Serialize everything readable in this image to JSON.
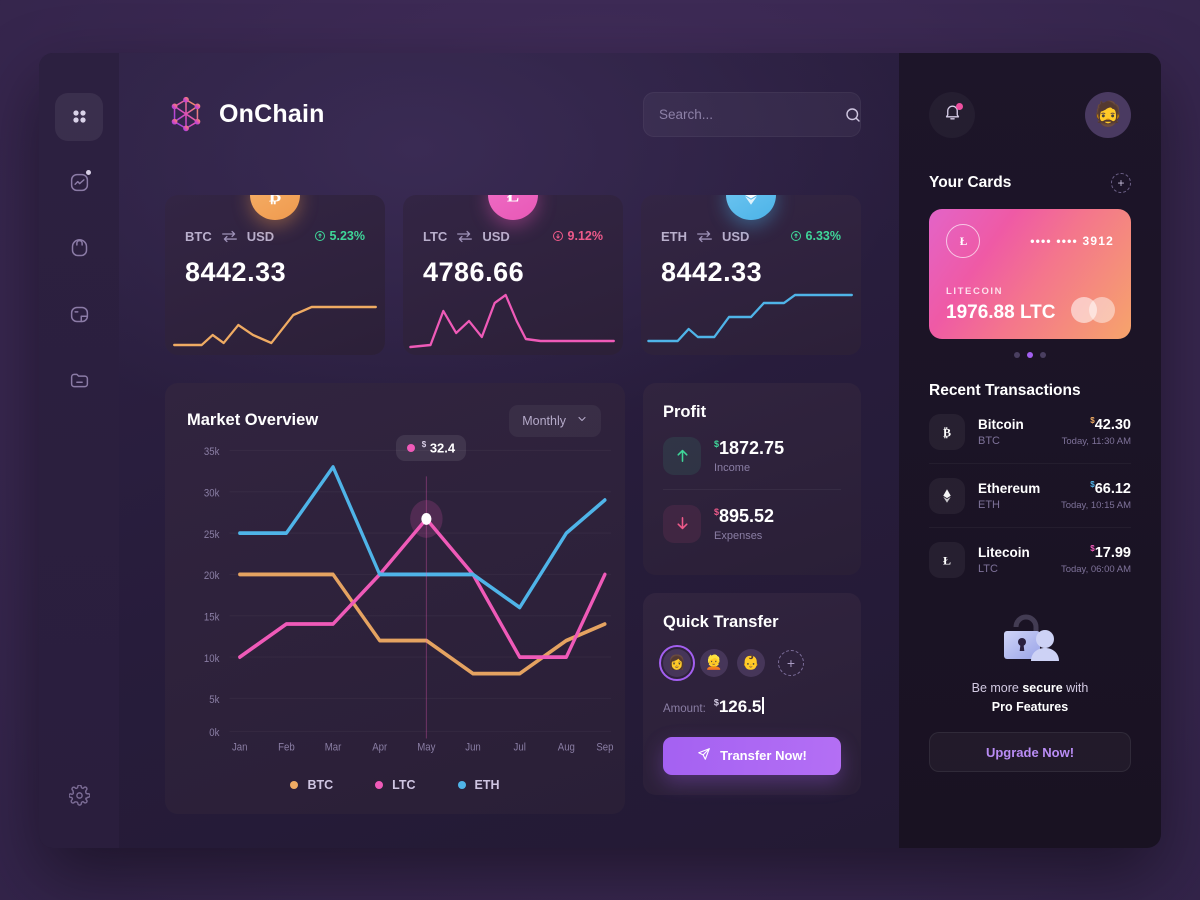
{
  "brand": {
    "name": "OnChain",
    "logo_icon": "hexagon-network-icon"
  },
  "sidebar": {
    "items": [
      {
        "name": "dashboard",
        "icon": "grid-icon",
        "active": true
      },
      {
        "name": "analytics",
        "icon": "chart-activity-icon",
        "active": false,
        "badge": true
      },
      {
        "name": "wallet",
        "icon": "bag-icon",
        "active": false
      },
      {
        "name": "portfolio",
        "icon": "pie-chart-icon",
        "active": false
      },
      {
        "name": "files",
        "icon": "folder-minus-icon",
        "active": false
      }
    ],
    "settings": {
      "name": "settings",
      "icon": "gear-icon"
    }
  },
  "search": {
    "placeholder": "Search...",
    "value": "",
    "icon": "search-icon"
  },
  "header": {
    "bell_icon": "bell-icon",
    "avatar_icon": "user-avatar",
    "notification_badge": true
  },
  "coin_cards": [
    {
      "symbol": "BTC",
      "quote": "USD",
      "change": "5.23%",
      "direction": "up",
      "value": "8442.33",
      "color": "#ef9a4e",
      "icon": "bitcoin-icon"
    },
    {
      "symbol": "LTC",
      "quote": "USD",
      "change": "9.12%",
      "direction": "down",
      "value": "4786.66",
      "color": "#e858b6",
      "icon": "litecoin-icon"
    },
    {
      "symbol": "ETH",
      "quote": "USD",
      "change": "6.33%",
      "direction": "up",
      "value": "8442.33",
      "color": "#4bb3e8",
      "icon": "ethereum-icon"
    }
  ],
  "market": {
    "title": "Market Overview",
    "period": "Monthly",
    "tooltip": {
      "currency": "$",
      "value": "32.4",
      "series": "LTC",
      "at_category": "May"
    }
  },
  "chart_data": {
    "type": "line",
    "title": "Market Overview",
    "xlabel": "",
    "ylabel": "",
    "categories": [
      "Jan",
      "Feb",
      "Mar",
      "Apr",
      "May",
      "Jun",
      "Jul",
      "Aug",
      "Sep"
    ],
    "ylim": [
      0,
      35000
    ],
    "yticks": [
      0,
      5000,
      10000,
      15000,
      20000,
      25000,
      30000,
      35000
    ],
    "ytick_labels": [
      "0k",
      "5k",
      "10k",
      "15k",
      "20k",
      "25k",
      "30k",
      "35k"
    ],
    "grid": true,
    "legend_position": "bottom",
    "series": [
      {
        "name": "BTC",
        "color": "#efab63",
        "values": [
          20000,
          20000,
          20000,
          12000,
          12000,
          8000,
          8000,
          12000,
          17000
        ]
      },
      {
        "name": "LTC",
        "color": "#ef5ab8",
        "values": [
          10000,
          14000,
          14000,
          20000,
          32400,
          20000,
          10000,
          10000,
          20000
        ]
      },
      {
        "name": "ETH",
        "color": "#4fb4e8",
        "values": [
          25000,
          25000,
          34000,
          20000,
          20000,
          20000,
          16000,
          25000,
          30000
        ]
      }
    ]
  },
  "profit": {
    "title": "Profit",
    "rows": [
      {
        "currency": "$",
        "value": "1872.75",
        "label": "Income",
        "direction": "up",
        "icon": "arrow-up-icon"
      },
      {
        "currency": "$",
        "value": "895.52",
        "label": "Expenses",
        "direction": "down",
        "icon": "arrow-down-icon"
      }
    ]
  },
  "quick_transfer": {
    "title": "Quick Transfer",
    "contacts": [
      {
        "name": "contact-1",
        "emoji": "👩",
        "selected": true
      },
      {
        "name": "contact-2",
        "emoji": "👱",
        "selected": false
      },
      {
        "name": "contact-3",
        "emoji": "👶",
        "selected": false
      }
    ],
    "add_label": "+",
    "amount_label": "Amount:",
    "amount_currency": "$",
    "amount_value": "126.5",
    "button_label": "Transfer Now!",
    "button_icon": "send-icon"
  },
  "cards_panel": {
    "title": "Your Cards",
    "add_label": "+",
    "card": {
      "masked_number": "••••  ••••  3912",
      "brand": "LITECOIN",
      "amount": "1976.88 LTC",
      "logo_icon": "litecoin-icon"
    },
    "pager": {
      "count": 3,
      "active_index": 1
    }
  },
  "transactions": {
    "title": "Recent Transactions",
    "items": [
      {
        "name": "Bitcoin",
        "symbol": "BTC",
        "currency": "$",
        "amount": "42.30",
        "time": "Today, 11:30 AM",
        "icon": "bitcoin-icon",
        "currency_color": "#efab63"
      },
      {
        "name": "Ethereum",
        "symbol": "ETH",
        "currency": "$",
        "amount": "66.12",
        "time": "Today, 10:15 AM",
        "icon": "ethereum-icon",
        "currency_color": "#4fb4e8"
      },
      {
        "name": "Litecoin",
        "symbol": "LTC",
        "currency": "$",
        "amount": "17.99",
        "time": "Today, 06:00 AM",
        "icon": "litecoin-icon",
        "currency_color": "#ef5ab8"
      }
    ]
  },
  "promo": {
    "icon": "lock-user-icon",
    "line1_pre": "Be more ",
    "line1_strong": "secure",
    "line1_post": " with",
    "line2": "Pro Features",
    "button_label": "Upgrade Now!"
  },
  "colors": {
    "accent": "#a35ff0",
    "up": "#3fd699",
    "down": "#ef5a8a",
    "btc": "#efab63",
    "ltc": "#ef5ab8",
    "eth": "#4fb4e8"
  }
}
